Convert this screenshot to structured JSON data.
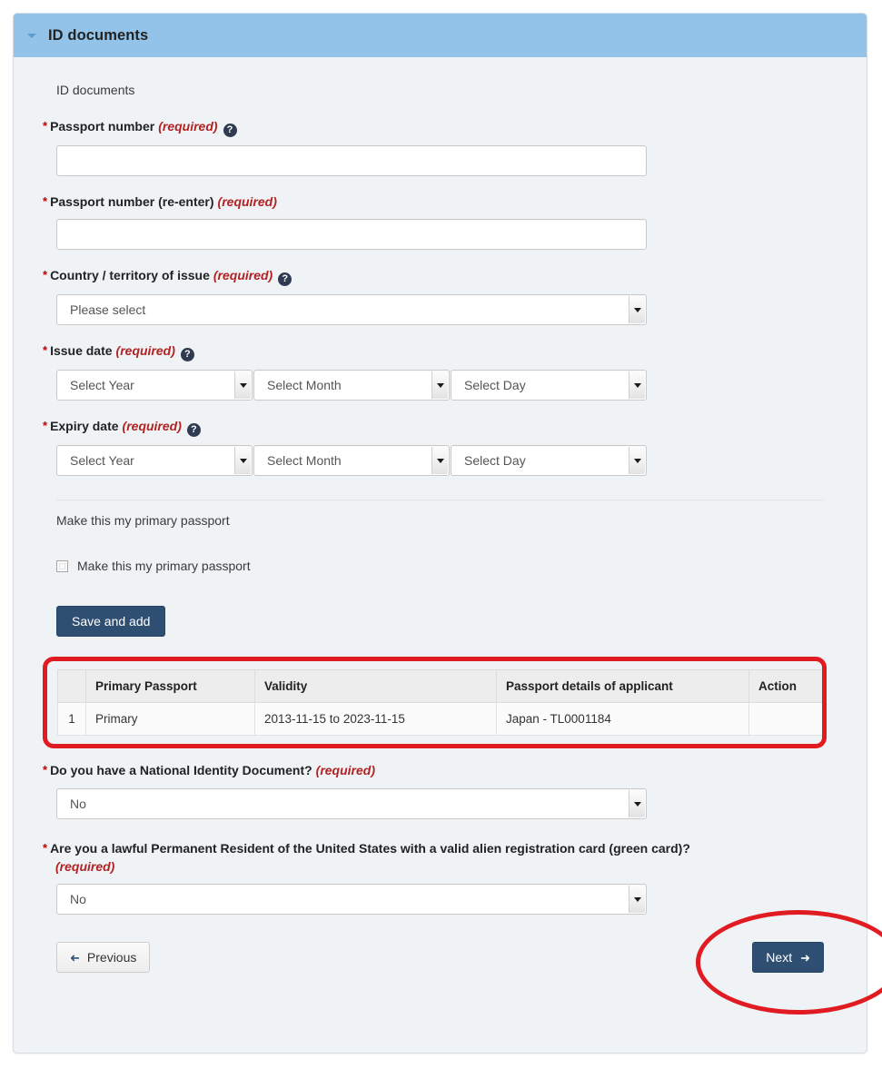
{
  "panel": {
    "title": "ID documents",
    "caret_icon": "chevron-down-icon",
    "section_label": "ID documents"
  },
  "labels": {
    "required_star": "*",
    "required_text": "(required)",
    "help_icon": "?"
  },
  "fields": {
    "passport_number": {
      "label": "Passport number",
      "value": "",
      "placeholder": ""
    },
    "passport_number_reenter": {
      "label": "Passport number (re-enter)",
      "value": "",
      "placeholder": ""
    },
    "country_of_issue": {
      "label": "Country / territory of issue",
      "value": "Please select"
    },
    "issue_date": {
      "label": "Issue date",
      "year": "Select Year",
      "month": "Select Month",
      "day": "Select Day"
    },
    "expiry_date": {
      "label": "Expiry date",
      "year": "Select Year",
      "month": "Select Month",
      "day": "Select Day"
    },
    "primary_passport": {
      "heading": "Make this my primary passport",
      "checkbox_label": "Make this my primary passport",
      "checked": false
    },
    "national_identity_document": {
      "label": "Do you have a National Identity Document?",
      "value": "No"
    },
    "permanent_resident": {
      "label": "Are you a lawful Permanent Resident of the United States with a valid alien registration card (green card)?",
      "value": "No"
    }
  },
  "buttons": {
    "save_and_add": "Save and add",
    "previous": "Previous",
    "next": "Next",
    "previous_icon": "arrow-left-icon",
    "next_icon": "arrow-right-icon"
  },
  "table": {
    "headers": [
      "",
      "Primary Passport",
      "Validity",
      "Passport details of applicant",
      "Action"
    ],
    "rows": [
      {
        "index": "1",
        "primary_passport": "Primary",
        "validity": "2013-11-15 to 2023-11-15",
        "details": "Japan - TL0001184",
        "action": ""
      }
    ]
  },
  "colors": {
    "header_blue": "#93c3e8",
    "panel_bg": "#eff3f6",
    "primary_button": "#2e4f72",
    "required_red": "#b22222",
    "annotation_red": "#e11b22"
  }
}
